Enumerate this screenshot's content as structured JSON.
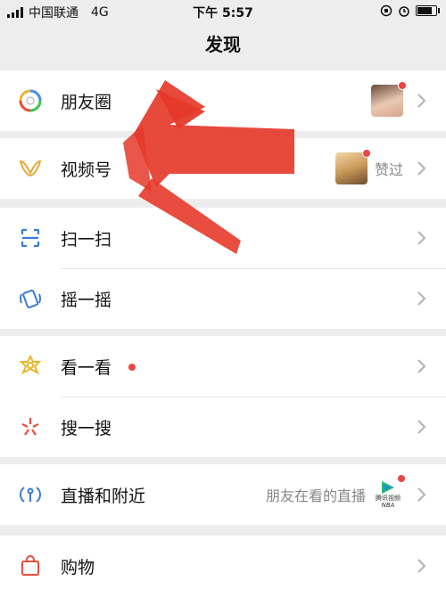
{
  "status_bar": {
    "carrier": "中国联通",
    "network": "4G",
    "time": "下午 5:57"
  },
  "page": {
    "title": "发现"
  },
  "items": [
    {
      "label": "朋友圈",
      "icon": "moments-icon"
    },
    {
      "label": "视频号",
      "icon": "channels-icon",
      "extra_text": "赞过"
    },
    {
      "label": "扫一扫",
      "icon": "scan-icon"
    },
    {
      "label": "摇一摇",
      "icon": "shake-icon"
    },
    {
      "label": "看一看",
      "icon": "top-stories-icon"
    },
    {
      "label": "搜一搜",
      "icon": "search-icon"
    },
    {
      "label": "直播和附近",
      "icon": "live-nearby-icon",
      "extra_text": "朋友在看的直播",
      "badge_text": "腾讯视频",
      "badge_sub": "NBA"
    },
    {
      "label": "购物",
      "icon": "shopping-icon"
    }
  ],
  "colors": {
    "accent_red": "#e53a2a",
    "background": "#ededed"
  }
}
